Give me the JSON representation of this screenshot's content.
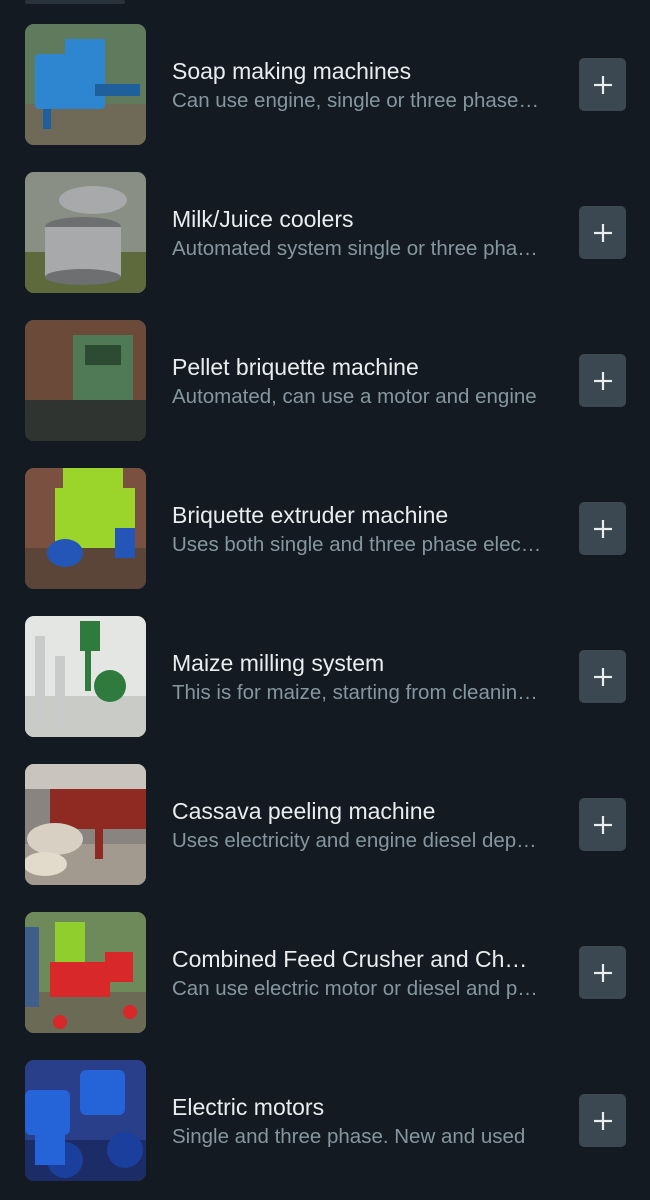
{
  "products": [
    {
      "title": "Soap making machines",
      "subtitle": "Can use engine, single or three phase electricity",
      "thumb_icon": "soap-machine-photo",
      "thumb_colors": {
        "bg": "#5f7a5c",
        "ground": "#6f6a57",
        "machine": "#2f86d0",
        "accent": "#1e5f9c"
      }
    },
    {
      "title": "Milk/Juice coolers",
      "subtitle": "Automated system single or three phase electricity",
      "thumb_icon": "milk-cooler-photo",
      "thumb_colors": {
        "bg": "#8a8f86",
        "ground": "#5e6a3c",
        "machine": "#a7a9aa",
        "accent": "#6d6f70"
      }
    },
    {
      "title": "Pellet briquette machine",
      "subtitle": "Automated, can use a motor and engine",
      "thumb_icon": "pellet-machine-photo",
      "thumb_colors": {
        "bg": "#6b4a3a",
        "ground": "#2f3430",
        "machine": "#4f7a55",
        "accent": "#2d4a33"
      }
    },
    {
      "title": "Briquette extruder machine",
      "subtitle": "Uses both single and three phase electricity",
      "thumb_icon": "extruder-machine-photo",
      "thumb_colors": {
        "bg": "#7a5040",
        "ground": "#5a4538",
        "machine": "#9bd42a",
        "accent": "#2456b8"
      }
    },
    {
      "title": "Maize milling system",
      "subtitle": "This is for maize, starting from cleaning to milling",
      "thumb_icon": "maize-mill-photo",
      "thumb_colors": {
        "bg": "#e4e6e3",
        "ground": "#c9ccc6",
        "machine": "#2f7a3d",
        "accent": "#c8cbc9"
      }
    },
    {
      "title": "Cassava peeling machine",
      "subtitle": "Uses electricity and engine diesel depending on need",
      "thumb_icon": "cassava-peeler-photo",
      "thumb_colors": {
        "bg": "#8a8480",
        "ground": "#a39a8f",
        "machine": "#8e2a22",
        "accent": "#5a3a30"
      }
    },
    {
      "title": "Combined Feed Crusher and Chaff cutter",
      "subtitle": "Can use electric motor or diesel and petrol engine",
      "thumb_icon": "feed-crusher-photo",
      "thumb_colors": {
        "bg": "#6f8a5a",
        "ground": "#6b6a55",
        "machine": "#d8282a",
        "accent": "#8fce2c"
      }
    },
    {
      "title": "Electric motors",
      "subtitle": "Single and three phase. New and used",
      "thumb_icon": "electric-motor-photo",
      "thumb_colors": {
        "bg": "#2a3f8a",
        "ground": "#1c2c66",
        "machine": "#2463d8",
        "accent": "#1a3f9c"
      }
    }
  ],
  "add_button": {
    "icon": "plus-icon",
    "color": "#e9edef"
  }
}
